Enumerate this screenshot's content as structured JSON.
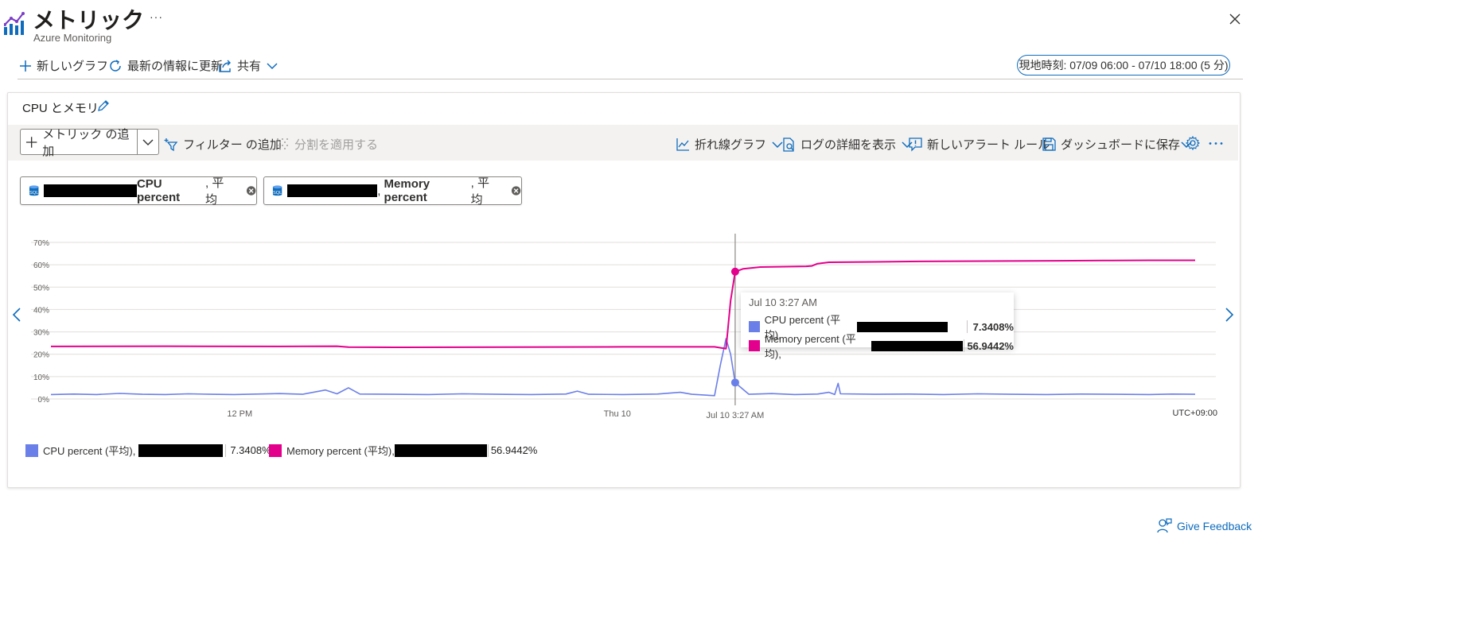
{
  "header": {
    "title": "メトリック",
    "subtitle": "Azure Monitoring",
    "more": "···"
  },
  "commands": {
    "new_chart": "新しいグラフ",
    "refresh": "最新の情報に更新",
    "share": "共有",
    "time_range": "現地時刻: 07/09 06:00 - 07/10 18:00 (5 分)"
  },
  "chart_card": {
    "title": "CPU とメモリ",
    "toolbar": {
      "add_metric": "メトリック の追加",
      "add_filter": "フィルター の追加",
      "apply_split": "分割を適用する",
      "line_chart": "折れ線グラフ",
      "view_logs": "ログの詳細を表示",
      "new_alert": "新しいアラート ルール",
      "save_dashboard": "ダッシュボードに保存"
    },
    "pills": [
      {
        "label": "CPU percent",
        "agg": ", 平均"
      },
      {
        "label": "Memory percent",
        "agg": ", 平均",
        "sep": ", "
      }
    ],
    "tooltip": {
      "time": "Jul 10 3:27 AM",
      "rows": [
        {
          "label": "CPU percent (平均),",
          "value": "7.3408%",
          "color": "#6b7fe8"
        },
        {
          "label": "Memory percent (平均),",
          "value": "56.9442%",
          "color": "#e3008c"
        }
      ]
    },
    "legend": [
      {
        "label": "CPU percent (平均),",
        "value": "7.3408%",
        "color": "#6b7fe8"
      },
      {
        "label": "Memory percent (平均),",
        "value": "56.9442%",
        "color": "#e3008c"
      }
    ],
    "cursor_label": "Jul 10 3:27 AM",
    "timezone": "UTC+09:00"
  },
  "feedback": "Give Feedback",
  "chart_data": {
    "type": "line",
    "y_ticks": [
      "0%",
      "10%",
      "20%",
      "30%",
      "40%",
      "50%",
      "60%",
      "70%"
    ],
    "ylim": [
      0,
      70
    ],
    "x_tick_labels": [
      "12 PM",
      "Thu 10"
    ],
    "x_range": [
      "07/09 06:00",
      "07/10 18:00"
    ],
    "series": [
      {
        "name": "CPU percent (平均)",
        "color": "#6b7fe8",
        "points": [
          [
            0,
            2
          ],
          [
            2,
            2.2
          ],
          [
            4,
            2
          ],
          [
            6,
            2.5
          ],
          [
            8,
            2.1
          ],
          [
            10,
            2
          ],
          [
            12,
            2.3
          ],
          [
            14,
            2.1
          ],
          [
            16,
            2
          ],
          [
            18,
            2.2
          ],
          [
            20,
            2.4
          ],
          [
            22,
            2.1
          ],
          [
            24,
            4
          ],
          [
            25,
            2.3
          ],
          [
            26,
            5
          ],
          [
            27,
            2.2
          ],
          [
            30,
            2.1
          ],
          [
            33,
            2
          ],
          [
            36,
            2.3
          ],
          [
            39,
            2.1
          ],
          [
            42,
            2
          ],
          [
            45,
            2.2
          ],
          [
            46,
            3.5
          ],
          [
            47,
            2.1
          ],
          [
            50,
            2
          ],
          [
            53,
            2.2
          ],
          [
            55,
            3
          ],
          [
            56,
            2.1
          ],
          [
            58,
            1.5
          ],
          [
            58.5,
            15
          ],
          [
            59,
            27
          ],
          [
            59.4,
            20
          ],
          [
            59.8,
            7.3
          ],
          [
            61,
            2.1
          ],
          [
            63,
            2.4
          ],
          [
            65,
            2
          ],
          [
            67,
            2.2
          ],
          [
            68,
            3
          ],
          [
            68.5,
            2
          ],
          [
            68.8,
            7
          ],
          [
            69,
            2.3
          ],
          [
            72,
            2.1
          ],
          [
            75,
            2.2
          ],
          [
            78,
            2
          ],
          [
            81,
            2.3
          ],
          [
            84,
            2.1
          ],
          [
            87,
            2
          ],
          [
            90,
            2.2
          ],
          [
            93,
            2.1
          ],
          [
            96,
            2
          ],
          [
            98,
            2.2
          ],
          [
            100,
            2.1
          ]
        ]
      },
      {
        "name": "Memory percent (平均)",
        "color": "#e3008c",
        "points": [
          [
            0,
            23.5
          ],
          [
            10,
            23.6
          ],
          [
            20,
            23.5
          ],
          [
            25,
            23.6
          ],
          [
            26,
            23.2
          ],
          [
            30,
            23.1
          ],
          [
            40,
            23.2
          ],
          [
            50,
            23.3
          ],
          [
            58,
            23.3
          ],
          [
            59,
            22.5
          ],
          [
            59.4,
            44
          ],
          [
            59.8,
            56.9
          ],
          [
            60.5,
            58.2
          ],
          [
            62,
            59
          ],
          [
            66,
            59.3
          ],
          [
            66.5,
            59.5
          ],
          [
            67,
            60.5
          ],
          [
            68,
            61.1
          ],
          [
            72,
            61.3
          ],
          [
            76,
            61.5
          ],
          [
            80,
            61.6
          ],
          [
            84,
            61.7
          ],
          [
            88,
            61.8
          ],
          [
            92,
            61.9
          ],
          [
            96,
            62
          ],
          [
            100,
            62
          ]
        ]
      }
    ],
    "cursor": {
      "x": 59.8,
      "label": "Jul 10 3:27 AM"
    }
  }
}
